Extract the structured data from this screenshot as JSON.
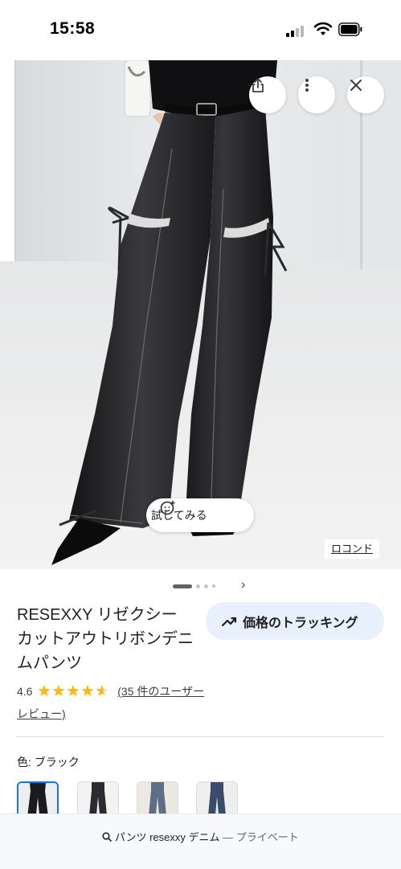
{
  "status_bar": {
    "time": "15:58"
  },
  "hero": {
    "try_on_label": "試してみる",
    "source_label": "ロコンド",
    "actions": [
      {
        "name": "share-icon"
      },
      {
        "name": "more-vert-icon"
      },
      {
        "name": "close-icon"
      }
    ]
  },
  "gallery": {
    "count": 4,
    "active_index": 0,
    "next_label": "›"
  },
  "product": {
    "title": "RESEXXY リゼクシー カットアウトリボンデニムパンツ",
    "rating_value": "4.6",
    "rating": 4.6,
    "reviews_link": "(35 件のユーザー レビュー)",
    "track_price_label": "価格のトラッキング"
  },
  "variants": {
    "color_label": "色: ブラック",
    "swatch_count": 4,
    "selected_index": 0
  },
  "bottom_bar": {
    "query": "パンツ resexxy デニム",
    "separator": " — ",
    "private_label": "プライベート"
  },
  "colors": {
    "accent_blue": "#1a73e8",
    "chip_bg": "#e8f0fe",
    "star_yellow": "#fbbc04",
    "denim_black": "#1b1b1d"
  }
}
